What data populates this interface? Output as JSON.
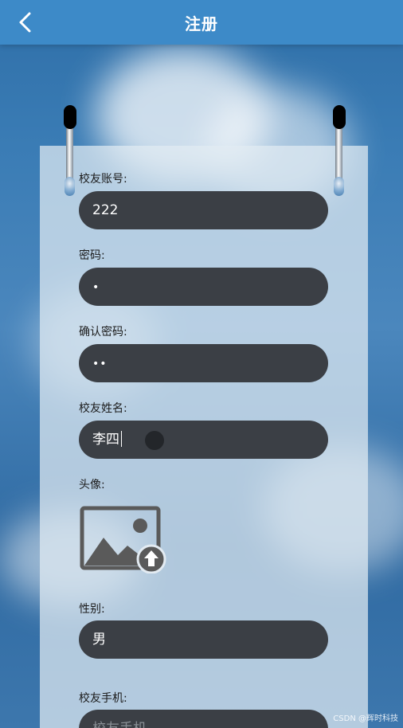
{
  "header": {
    "title": "注册",
    "back_icon": "chevron-left-icon",
    "background": "#3d8ac8"
  },
  "form": {
    "account": {
      "label": "校友账号:",
      "value": "222"
    },
    "password": {
      "label": "密码:",
      "value": "•"
    },
    "confirm_password": {
      "label": "确认密码:",
      "value": "••"
    },
    "name": {
      "label": "校友姓名:",
      "value": "李四"
    },
    "avatar": {
      "label": "头像:",
      "icon": "image-upload-icon"
    },
    "gender": {
      "label": "性别:",
      "value": "男"
    },
    "phone": {
      "label": "校友手机:",
      "placeholder": "校友手机"
    }
  },
  "colors": {
    "input_bg": "#3b3f45",
    "panel_bg": "rgba(226,235,243,0.72)"
  },
  "watermark": "CSDN @辉时科技"
}
